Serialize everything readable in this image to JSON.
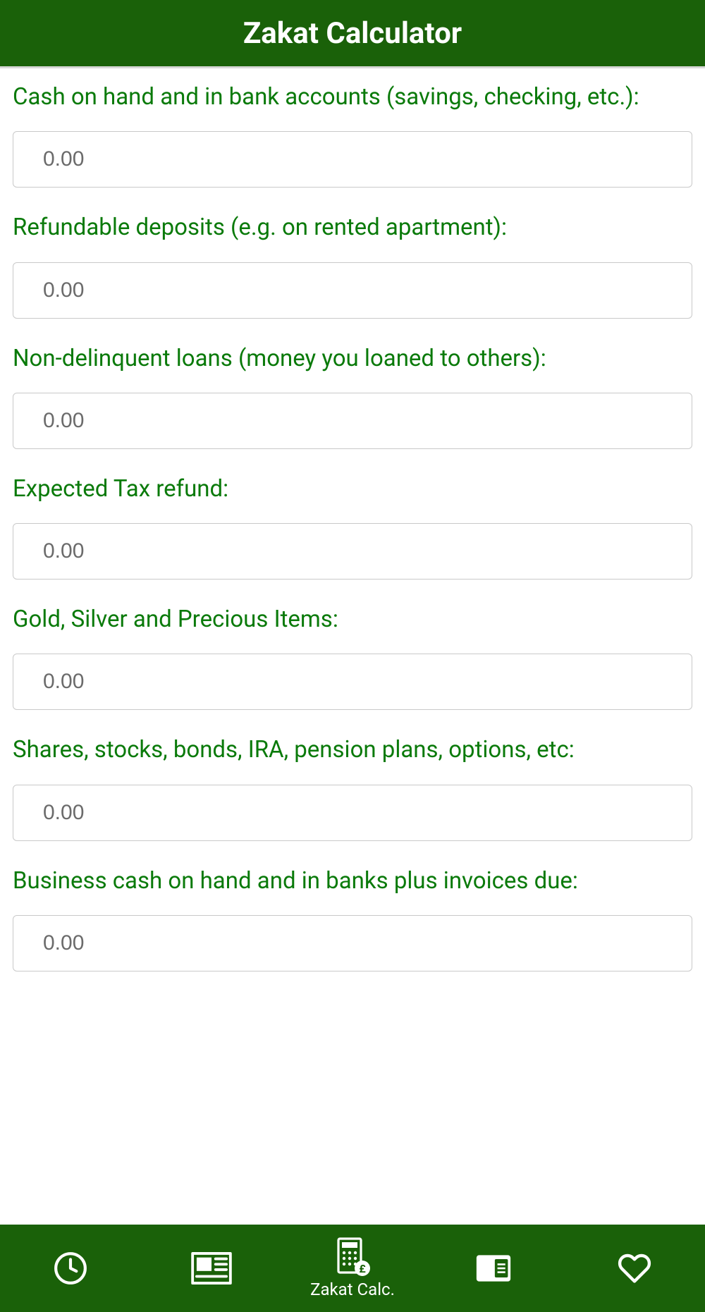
{
  "header": {
    "title": "Zakat Calculator"
  },
  "fields": [
    {
      "label": "Cash on hand and in bank accounts (savings, checking, etc.):",
      "placeholder": "0.00",
      "value": ""
    },
    {
      "label": "Refundable deposits (e.g. on rented apartment):",
      "placeholder": "0.00",
      "value": ""
    },
    {
      "label": "Non-delinquent loans (money you loaned to others):",
      "placeholder": "0.00",
      "value": ""
    },
    {
      "label": "Expected Tax refund:",
      "placeholder": "0.00",
      "value": ""
    },
    {
      "label": "Gold, Silver and Precious Items:",
      "placeholder": "0.00",
      "value": ""
    },
    {
      "label": "Shares, stocks, bonds, IRA, pension plans, options, etc:",
      "placeholder": "0.00",
      "value": ""
    },
    {
      "label": "Business cash on hand and in banks plus invoices due:",
      "placeholder": "0.00",
      "value": ""
    }
  ],
  "nav": {
    "items": [
      {
        "icon": "clock-icon",
        "label": ""
      },
      {
        "icon": "news-icon",
        "label": ""
      },
      {
        "icon": "calculator-icon",
        "label": "Zakat Calc."
      },
      {
        "icon": "book-icon",
        "label": ""
      },
      {
        "icon": "heart-icon",
        "label": ""
      }
    ]
  },
  "colors": {
    "brand": "#1a6109",
    "label": "#0a7a0a"
  }
}
